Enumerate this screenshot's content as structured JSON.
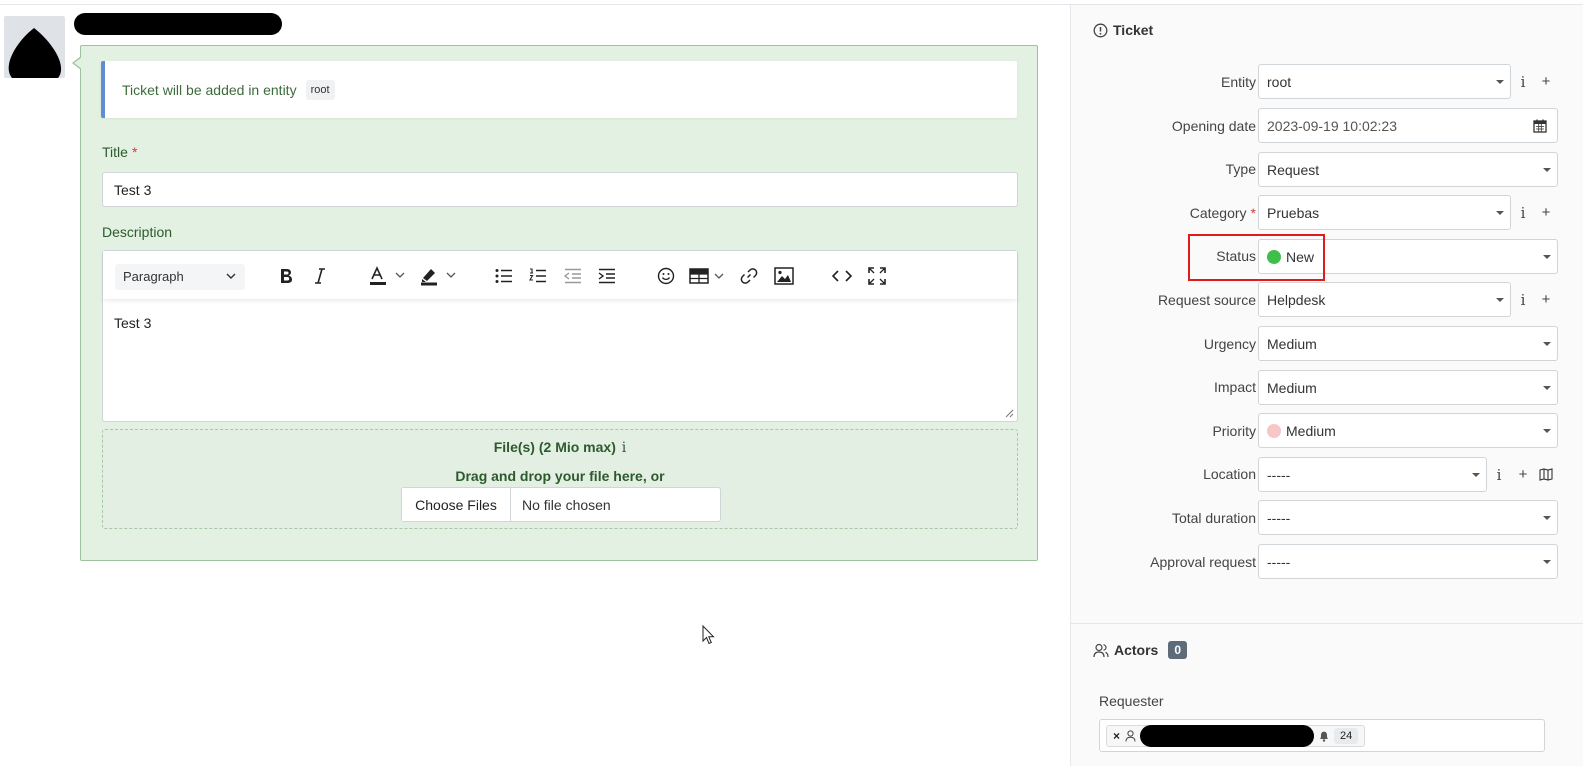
{
  "alert": {
    "text": "Ticket will be added in entity",
    "entity_badge": "root"
  },
  "form": {
    "title_label": "Title",
    "required_mark": "*",
    "title_value": "Test 3",
    "description_label": "Description",
    "paragraph_select": "Paragraph",
    "description_value": "Test 3",
    "files_label": "File(s) (2 Mio max)",
    "files_info": "i",
    "drag_text": "Drag and drop your file here, or",
    "choose_files": "Choose Files",
    "no_file": "No file chosen"
  },
  "ticket_panel": {
    "section_title": "Ticket",
    "required_mark": "*",
    "fields": {
      "entity": {
        "label": "Entity",
        "value": "root"
      },
      "opening_date": {
        "label": "Opening date",
        "value": "2023-09-19 10:02:23"
      },
      "type": {
        "label": "Type",
        "value": "Request"
      },
      "category": {
        "label": "Category",
        "value": "Pruebas"
      },
      "status": {
        "label": "Status",
        "value": "New",
        "color": "#3fbf4a"
      },
      "request_source": {
        "label": "Request source",
        "value": "Helpdesk"
      },
      "urgency": {
        "label": "Urgency",
        "value": "Medium"
      },
      "impact": {
        "label": "Impact",
        "value": "Medium"
      },
      "priority": {
        "label": "Priority",
        "value": "Medium",
        "color": "#f7c6c6"
      },
      "location": {
        "label": "Location",
        "value": "-----"
      },
      "total_duration": {
        "label": "Total duration",
        "value": "-----"
      },
      "approval_request": {
        "label": "Approval request",
        "value": "-----"
      }
    },
    "buttons": {
      "info": "i",
      "add": "+"
    }
  },
  "actors_panel": {
    "section_title": "Actors",
    "count": "0",
    "requester_label": "Requester",
    "requester_remove": "×",
    "requester_count": "24"
  },
  "colors": {
    "accent_border": "#5e8fd6",
    "form_bg": "#e2f1e2",
    "highlight": "#e01b1b"
  }
}
